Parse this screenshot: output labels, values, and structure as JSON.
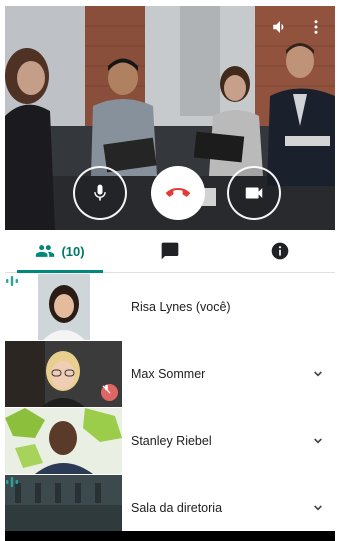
{
  "video": {
    "icons": [
      "volume-icon",
      "more-vert-icon"
    ],
    "controls": [
      "mic-icon",
      "hangup-icon",
      "videocam-icon"
    ]
  },
  "tabs": [
    {
      "icon": "people-icon",
      "count": "(10)",
      "active": true
    },
    {
      "icon": "chat-icon",
      "active": false
    },
    {
      "icon": "info-icon",
      "active": false
    }
  ],
  "participants": [
    {
      "name": "Risa Lynes (você)",
      "status": "speaking",
      "expandable": false
    },
    {
      "name": "Max Sommer",
      "status": "muted",
      "expandable": true
    },
    {
      "name": "Stanley Riebel",
      "status": "none",
      "expandable": true
    },
    {
      "name": "Sala da diretoria",
      "status": "speaking",
      "expandable": true
    }
  ],
  "colors": {
    "accent": "#00897b",
    "hangup": "#e53935",
    "muted": "#e06666",
    "speaking": "#26a69a"
  }
}
